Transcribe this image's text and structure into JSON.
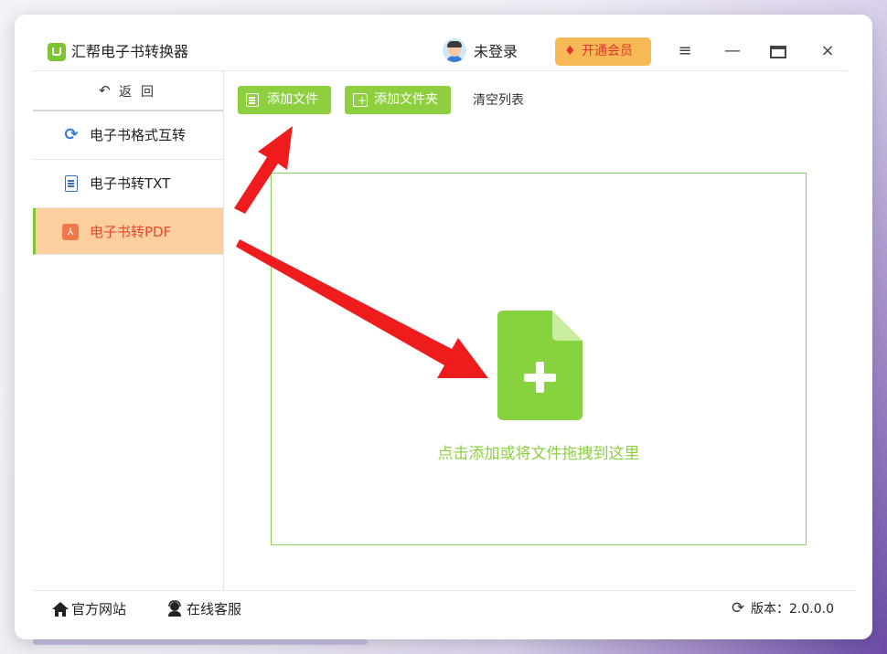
{
  "app": {
    "title": "汇帮电子书转换器"
  },
  "header": {
    "user_label": "未登录",
    "vip_label": "开通会员",
    "menu_glyph": "≡",
    "minimize_glyph": "—",
    "close_glyph": "×"
  },
  "sidebar": {
    "back_label": "返回",
    "items": [
      {
        "label": "电子书格式互转",
        "icon": "sync-icon"
      },
      {
        "label": "电子书转TXT",
        "icon": "text-file-icon"
      },
      {
        "label": "电子书转PDF",
        "icon": "pdf-icon",
        "active": true
      }
    ]
  },
  "toolbar": {
    "add_file_label": "添加文件",
    "add_folder_label": "添加文件夹",
    "clear_list_label": "清空列表"
  },
  "dropzone": {
    "hint": "点击添加或将文件拖拽到这里"
  },
  "footer": {
    "website_label": "官方网站",
    "support_label": "在线客服",
    "version_label": "版本：2.0.0.0"
  },
  "colors": {
    "accent_green": "#8dcf3e",
    "active_nav_bg": "#fdcf9f",
    "active_nav_text": "#e54a2c",
    "vip_bg": "#f7b955",
    "annotation_arrow": "#ee1c1c"
  }
}
